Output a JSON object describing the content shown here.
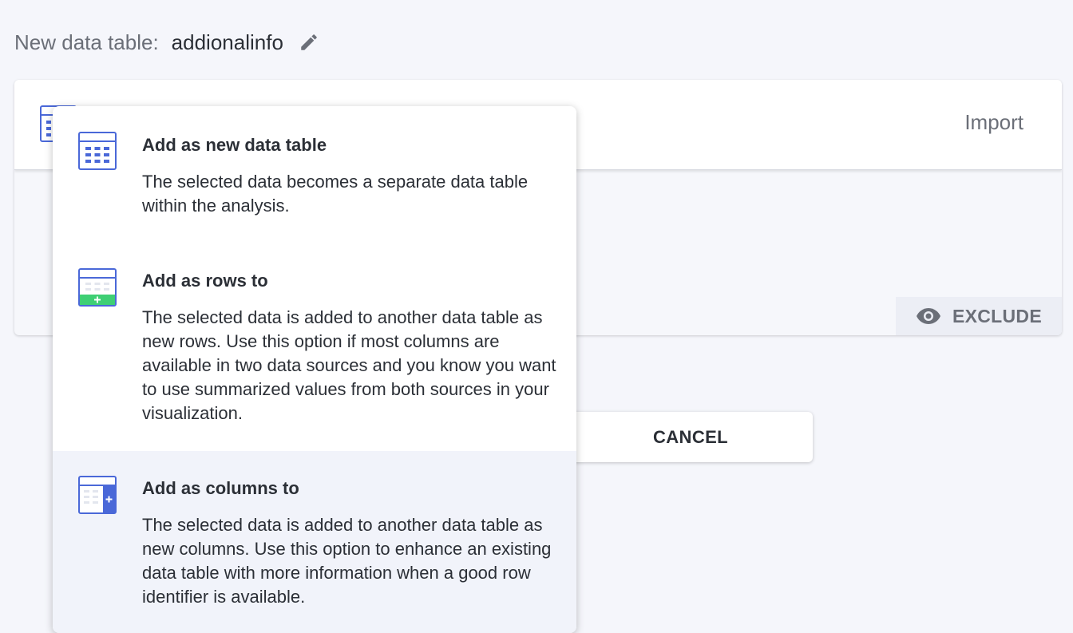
{
  "header": {
    "label": "New data table:",
    "name": "addionalinfo"
  },
  "card": {
    "import_label": "Import",
    "exclude_label": "EXCLUDE"
  },
  "dialog": {
    "cancel_label": "CANCEL"
  },
  "menu": {
    "items": [
      {
        "title": "Add as new data table",
        "description": "The selected data becomes a separate data table within the analysis.",
        "icon": "new-table-icon"
      },
      {
        "title": "Add as rows to",
        "description": "The selected data is added to another data table as new rows. Use this option if most columns are available in two data sources and you know you want to use summarized values from both sources in your visualization.",
        "icon": "add-rows-icon"
      },
      {
        "title": "Add as columns to",
        "description": "The selected data is added to another data table as new columns. Use this option to enhance an existing data table with more information when a good row identifier is available.",
        "icon": "add-columns-icon"
      }
    ]
  },
  "colors": {
    "accent": "#4a68d8",
    "success": "#3ecf74",
    "highlight": "#f1f3fa"
  }
}
